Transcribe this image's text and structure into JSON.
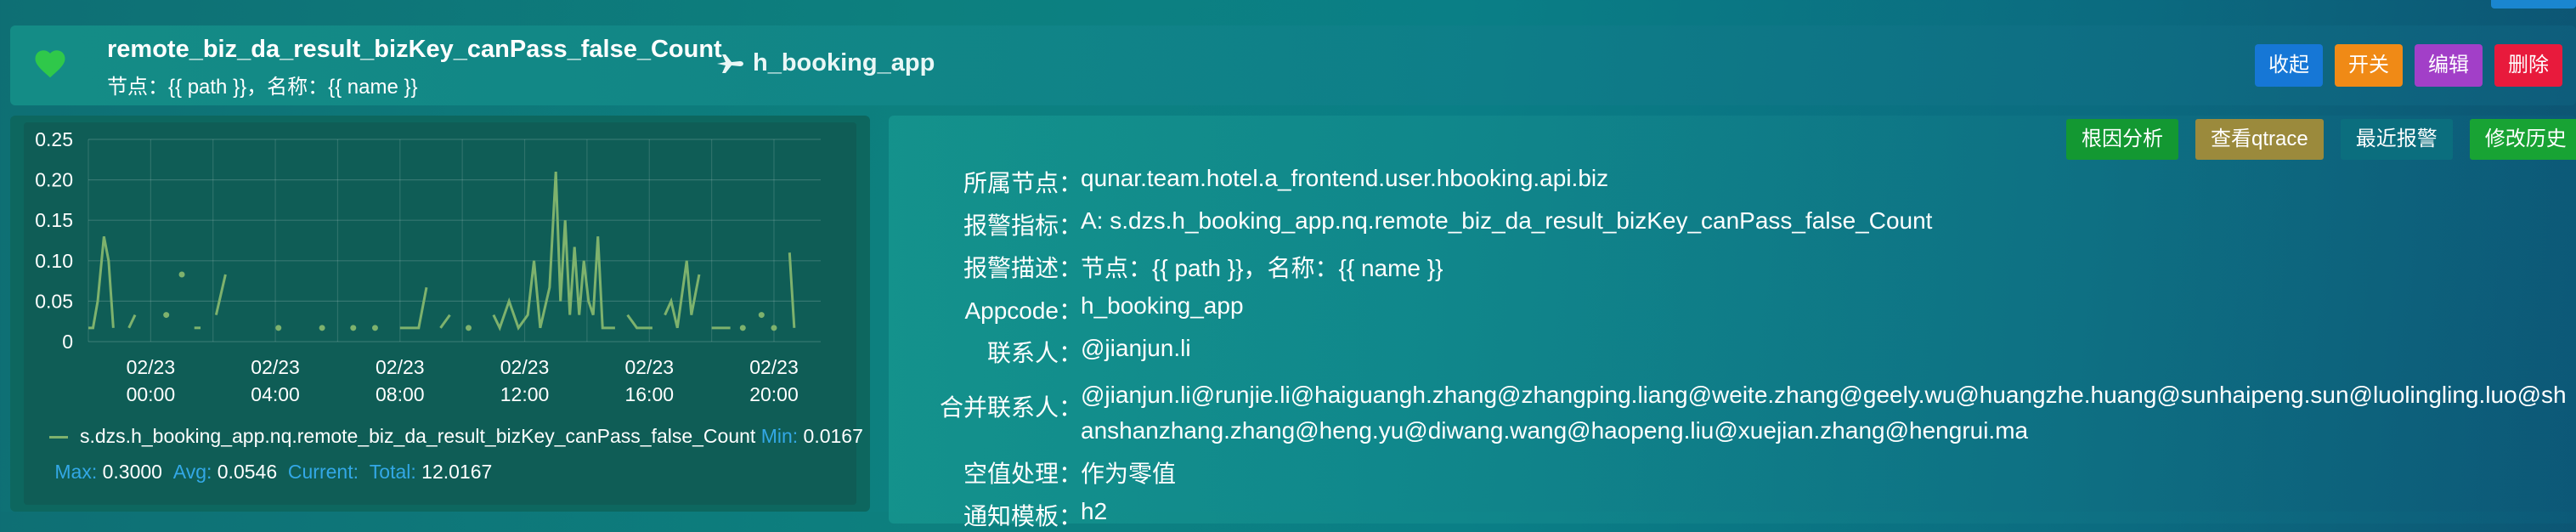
{
  "header": {
    "title": "remote_biz_da_result_bizKey_canPass_false_Count",
    "subtitle": "节点：{{ path }}，名称：{{ name }}",
    "app": "h_booking_app",
    "status_color": "#2fc84a",
    "buttons": {
      "collapse": "收起",
      "toggle": "开关",
      "edit": "编辑",
      "delete": "删除"
    }
  },
  "detail": {
    "buttons": {
      "root_cause": "根因分析",
      "qtrace": "查看qtrace",
      "recent_alerts": "最近报警",
      "history": "修改历史"
    },
    "fields": [
      {
        "label": "所属节点：",
        "value": "qunar.team.hotel.a_frontend.user.hbooking.api.biz"
      },
      {
        "label": "报警指标：",
        "value": "A: s.dzs.h_booking_app.nq.remote_biz_da_result_bizKey_canPass_false_Count"
      },
      {
        "label": "报警描述：",
        "value": "节点：{{ path }}，名称：{{ name }}"
      },
      {
        "label": "Appcode：",
        "value": "h_booking_app"
      },
      {
        "label": "联系人：",
        "value": "@jianjun.li"
      },
      {
        "label": "合并联系人：",
        "value": "@jianjun.li@runjie.li@haiguangh.zhang@zhangping.liang@weite.zhang@geely.wu@huangzhe.huang@sunhaipeng.sun@luolingling.luo@shanshanzhang.zhang@heng.yu@diwang.wang@haopeng.liu@xuejian.zhang@hengrui.ma"
      },
      {
        "label": "空值处理：",
        "value": "作为零值"
      },
      {
        "label": "通知模板：",
        "value": "h2"
      }
    ]
  },
  "legend": {
    "series_name": "s.dzs.h_booking_app.nq.remote_biz_da_result_bizKey_canPass_false_Count",
    "min_label": "Min:",
    "min_value": "0.0167",
    "max_label": "Max:",
    "max_value": "0.3000",
    "avg_label": "Avg:",
    "avg_value": "0.0546",
    "current_label": "Current:",
    "current_value": "",
    "total_label": "Total:",
    "total_value": "12.0167"
  },
  "chart_data": {
    "type": "line",
    "series": [
      {
        "name": "s.dzs.h_booking_app.nq.remote_biz_da_result_bizKey_canPass_false_Count",
        "color": "#7eb26d",
        "points": [
          [
            0.0,
            0.017
          ],
          [
            0.15,
            0.017
          ],
          [
            0.3,
            0.05
          ],
          [
            0.5,
            0.13
          ],
          [
            0.65,
            0.1
          ],
          [
            0.8,
            0.017
          ],
          [
            1.3,
            0.017
          ],
          [
            1.5,
            0.033
          ],
          [
            2.5,
            0.033
          ],
          [
            3.0,
            0.083
          ],
          [
            3.4,
            0.017
          ],
          [
            3.6,
            0.017
          ],
          [
            4.1,
            0.033
          ],
          [
            4.4,
            0.083
          ],
          [
            6.1,
            0.017
          ],
          [
            7.5,
            0.017
          ],
          [
            8.5,
            0.017
          ],
          [
            9.2,
            0.017
          ],
          [
            10.0,
            0.017
          ],
          [
            10.3,
            0.017
          ],
          [
            10.6,
            0.017
          ],
          [
            10.85,
            0.067
          ],
          [
            11.3,
            0.017
          ],
          [
            11.6,
            0.033
          ],
          [
            12.2,
            0.017
          ],
          [
            13.0,
            0.033
          ],
          [
            13.2,
            0.017
          ],
          [
            13.5,
            0.05
          ],
          [
            13.8,
            0.017
          ],
          [
            14.1,
            0.033
          ],
          [
            14.3,
            0.1
          ],
          [
            14.5,
            0.017
          ],
          [
            14.8,
            0.067
          ],
          [
            15.0,
            0.21
          ],
          [
            15.15,
            0.05
          ],
          [
            15.3,
            0.15
          ],
          [
            15.45,
            0.033
          ],
          [
            15.6,
            0.117
          ],
          [
            15.75,
            0.033
          ],
          [
            15.9,
            0.1
          ],
          [
            16.05,
            0.05
          ],
          [
            16.2,
            0.033
          ],
          [
            16.35,
            0.13
          ],
          [
            16.5,
            0.017
          ],
          [
            16.7,
            0.017
          ],
          [
            16.9,
            0.017
          ],
          [
            17.3,
            0.033
          ],
          [
            17.6,
            0.017
          ],
          [
            17.8,
            0.017
          ],
          [
            18.1,
            0.017
          ],
          [
            18.5,
            0.033
          ],
          [
            18.7,
            0.05
          ],
          [
            18.9,
            0.017
          ],
          [
            19.2,
            0.1
          ],
          [
            19.35,
            0.033
          ],
          [
            19.6,
            0.083
          ],
          [
            20.0,
            0.017
          ],
          [
            20.3,
            0.017
          ],
          [
            20.6,
            0.017
          ],
          [
            21.0,
            0.017
          ],
          [
            21.6,
            0.033
          ],
          [
            22.0,
            0.017
          ],
          [
            22.5,
            0.11
          ],
          [
            22.65,
            0.017
          ]
        ]
      }
    ],
    "x_tick_labels": [
      {
        "x": 2,
        "date": "02/23",
        "time": "00:00"
      },
      {
        "x": 6,
        "date": "02/23",
        "time": "04:00"
      },
      {
        "x": 10,
        "date": "02/23",
        "time": "08:00"
      },
      {
        "x": 14,
        "date": "02/23",
        "time": "12:00"
      },
      {
        "x": 18,
        "date": "02/23",
        "time": "16:00"
      },
      {
        "x": 22,
        "date": "02/23",
        "time": "20:00"
      }
    ],
    "y_ticks": [
      "0",
      "0.05",
      "0.10",
      "0.15",
      "0.20",
      "0.25"
    ],
    "ylim": [
      0,
      0.25
    ],
    "grid": true,
    "legend_position": "bottom"
  }
}
